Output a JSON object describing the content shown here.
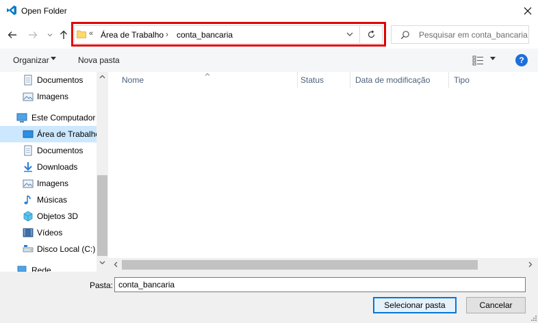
{
  "window": {
    "title": "Open Folder",
    "app_icon": "vscode-icon",
    "close_icon": "close-icon"
  },
  "nav": {
    "back_icon": "arrow-left-icon",
    "forward_icon": "arrow-right-icon",
    "recent_icon": "chevron-down-icon",
    "up_icon": "arrow-up-icon"
  },
  "address": {
    "overflow_chevron": "«",
    "crumbs": [
      "Área de Trabalho",
      "conta_bancaria"
    ],
    "separator": "›",
    "highlight_color": "#e10000"
  },
  "search": {
    "placeholder": "Pesquisar em conta_bancaria"
  },
  "toolbar": {
    "organize_label": "Organizar",
    "new_folder_label": "Nova pasta",
    "help_label": "?"
  },
  "sidebar": {
    "items": [
      {
        "label": "Documentos",
        "icon": "documents-icon",
        "selected": false
      },
      {
        "label": "Imagens",
        "icon": "pictures-icon",
        "selected": false
      },
      {
        "label": "Este Computador",
        "icon": "computer-icon",
        "selected": false
      },
      {
        "label": "Área de Trabalho",
        "icon": "desktop-icon",
        "selected": true
      },
      {
        "label": "Documentos",
        "icon": "documents-icon",
        "selected": false
      },
      {
        "label": "Downloads",
        "icon": "downloads-icon",
        "selected": false
      },
      {
        "label": "Imagens",
        "icon": "pictures-icon",
        "selected": false
      },
      {
        "label": "Músicas",
        "icon": "music-icon",
        "selected": false
      },
      {
        "label": "Objetos 3D",
        "icon": "objects-3d-icon",
        "selected": false
      },
      {
        "label": "Vídeos",
        "icon": "videos-icon",
        "selected": false
      },
      {
        "label": "Disco Local (C:)",
        "icon": "drive-icon",
        "selected": false
      },
      {
        "label": "Rede",
        "icon": "network-icon",
        "selected": false
      }
    ]
  },
  "columns": [
    {
      "label": "Nome"
    },
    {
      "label": "Status"
    },
    {
      "label": "Data de modificação"
    },
    {
      "label": "Tipo"
    }
  ],
  "bottom": {
    "folder_label": "Pasta:",
    "folder_value": "conta_bancaria",
    "select_button": "Selecionar pasta",
    "cancel_button": "Cancelar"
  },
  "colors": {
    "selected_bg": "#cce8ff",
    "accent": "#0078d7",
    "header_text": "#4c607a"
  }
}
